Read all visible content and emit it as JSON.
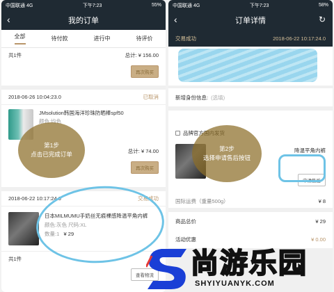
{
  "left_phone": {
    "status": {
      "carrier": "中国联通",
      "network": "4G",
      "time": "下午7:23",
      "battery": "55%"
    },
    "nav_title": "我的订单",
    "tabs": [
      "全部",
      "待付款",
      "进行中",
      "待评价"
    ],
    "order1": {
      "count": "共1件",
      "total": "总计: ¥ 156.00",
      "button": "再次购买"
    },
    "order2": {
      "datetime": "2018-06-26 10:04:23.0",
      "status": "已取消",
      "product": "JMsolution韩国海洋珍珠防晒棒spf50",
      "spec": "颜色:均色",
      "total": "总计: ¥ 74.00",
      "button": "再次购买"
    },
    "order3": {
      "datetime": "2018-06-22 10:17:24.0",
      "status": "交易成功",
      "product": "日本MILMUMU手奶丝无痕裸感降温平角内裤",
      "spec": "颜色:灰色 尺码:XL",
      "qty": "数量:1",
      "price": "¥ 29",
      "count": "共1件",
      "button": "查看物流"
    },
    "step_label": "第1步",
    "step_text": "点击已完成订单"
  },
  "right_phone": {
    "status": {
      "carrier": "中国联通",
      "network": "4G",
      "time": "下午7:23",
      "battery": "58%"
    },
    "nav_title": "订单详情",
    "header": {
      "status": "交易成功",
      "datetime": "2018-06-22 10:17:24.0"
    },
    "id_info": {
      "label": "新增身份信息:",
      "hint": "(选填)"
    },
    "store": "品牌官方国内发货",
    "product": "降温平角内裤",
    "after_sale_button": "申请售后",
    "shipping": "国际运费（重量500g）",
    "qty": "¥ 8",
    "summary": [
      {
        "label": "商品总价",
        "value": "¥ 29"
      },
      {
        "label": "活动优惠",
        "value": "¥ 0.00"
      }
    ],
    "step_label": "第2步",
    "step_text": "选择申请售后按钮"
  },
  "watermark": {
    "brand": "尚游乐园",
    "domain": "SHYIYUANYK.COM",
    "accent": "#1a3fd6"
  }
}
